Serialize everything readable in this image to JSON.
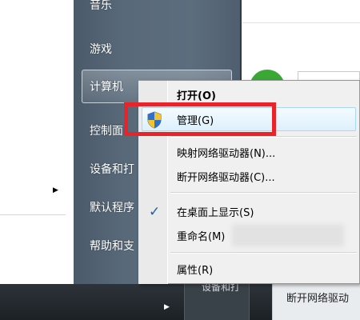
{
  "start_menu": {
    "items": [
      {
        "id": "music",
        "label": "音乐"
      },
      {
        "id": "games",
        "label": "游戏"
      },
      {
        "id": "computer",
        "label": "计算机"
      },
      {
        "id": "control-panel",
        "label": "控制面"
      },
      {
        "id": "devices",
        "label": "设备和打"
      },
      {
        "id": "default-programs",
        "label": "默认程序"
      },
      {
        "id": "help",
        "label": "帮助和支"
      }
    ]
  },
  "context_menu": {
    "open": "打开(O)",
    "manage": "管理(G)",
    "map_drive": "映射网络驱动器(N)...",
    "disconnect_drive": "断开网络驱动器(C)...",
    "show_on_desktop": "在桌面上显示(S)",
    "rename": "重命名(M)",
    "properties": "属性(R)"
  },
  "taskbar": {
    "item_label": "设备和打",
    "panel_label": "断开网络驱动"
  },
  "icons": {
    "shield": "uac-shield-icon",
    "check": "checkmark-icon",
    "arrow": "arrow-right-icon"
  },
  "colors": {
    "highlight_border": "#e8242a",
    "menu_hover": "#ddf0fc",
    "start_menu_bg": "#5c6d7e",
    "green_avatar": "#3aa835"
  }
}
